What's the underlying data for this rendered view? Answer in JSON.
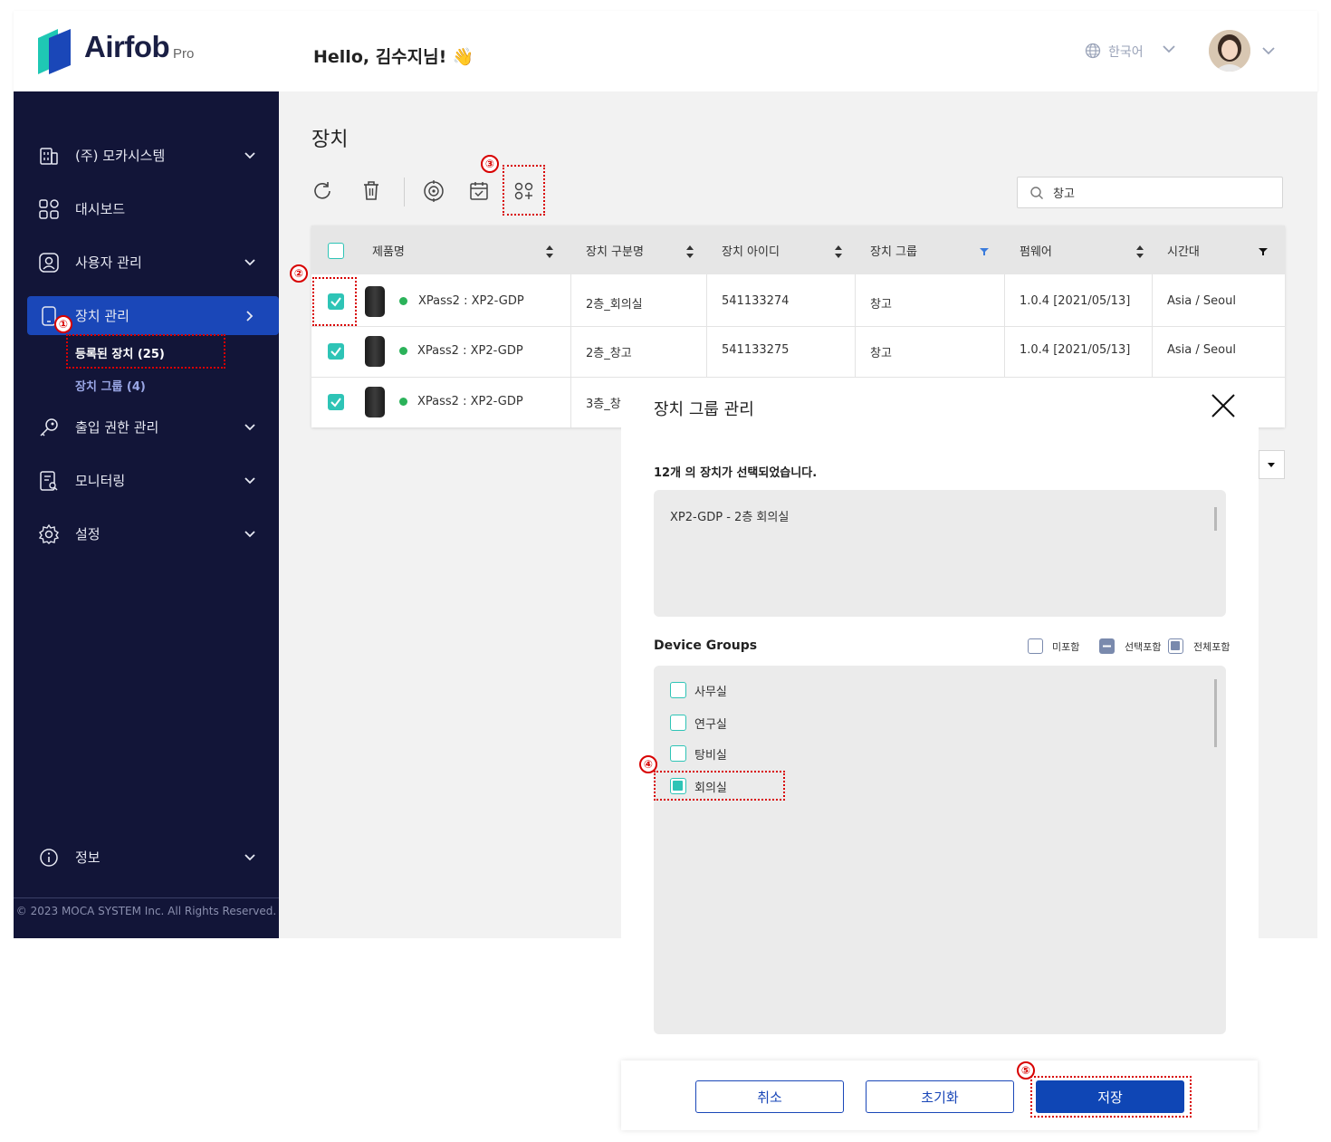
{
  "header": {
    "logo_text": "Airfob",
    "logo_sub": "Pro",
    "greeting": "Hello, 김수지님! 👋",
    "language": "한국어"
  },
  "sidebar": {
    "items": [
      {
        "label": "(주) 모카시스템",
        "icon": "building-icon"
      },
      {
        "label": "대시보드",
        "icon": "dashboard-icon"
      },
      {
        "label": "사용자 관리",
        "icon": "user-icon"
      },
      {
        "label": "장치 관리",
        "icon": "device-icon"
      },
      {
        "label": "출입 권한 관리",
        "icon": "key-icon"
      },
      {
        "label": "모니터링",
        "icon": "monitor-icon"
      },
      {
        "label": "설정",
        "icon": "gear-icon"
      },
      {
        "label": "정보",
        "icon": "info-icon"
      }
    ],
    "sub_items": [
      {
        "label": "등록된 장치 (25)"
      },
      {
        "label": "장치 그룹  (4)"
      }
    ],
    "copyright": "© 2023 MOCA SYSTEM Inc. All Rights Reserved."
  },
  "main": {
    "title": "장치",
    "search": {
      "value": "창고"
    },
    "table": {
      "columns": [
        "제품명",
        "장치 구분명",
        "장치 아이디",
        "장치 그룹",
        "펌웨어",
        "시간대"
      ],
      "rows": [
        {
          "product": "XPass2 : XP2-GDP",
          "name": "2층_회의실",
          "id": "541133274",
          "group": "창고",
          "firmware": "1.0.4 [2021/05/13]",
          "tz": "Asia / Seoul"
        },
        {
          "product": "XPass2 : XP2-GDP",
          "name": "2층_창고",
          "id": "541133275",
          "group": "창고",
          "firmware": "1.0.4 [2021/05/13]",
          "tz": "Asia / Seoul"
        },
        {
          "product": "XPass2 : XP2-GDP",
          "name": "3층_창",
          "id": "",
          "group": "",
          "firmware": "",
          "tz": ""
        }
      ]
    }
  },
  "modal": {
    "title": "장치 그룹 관리",
    "selected_text": "12개 의 장치가 선택되었습니다.",
    "selected_items": [
      "XP2-GDP - 2층 회의실"
    ],
    "groups_title": "Device Groups",
    "legend": [
      "미포함",
      "선택포함",
      "전체포함"
    ],
    "groups": [
      {
        "label": "사무실",
        "checked": false
      },
      {
        "label": "연구실",
        "checked": false
      },
      {
        "label": "탕비실",
        "checked": false
      },
      {
        "label": "회의실",
        "checked": true
      }
    ],
    "buttons": {
      "cancel": "취소",
      "reset": "초기화",
      "save": "저장"
    }
  },
  "annotations": [
    "①",
    "②",
    "③",
    "④",
    "⑤"
  ],
  "colors": {
    "sidebar_bg": "#121538",
    "active": "#1a47b8",
    "accent_teal": "#2ec4b6",
    "annotation": "#d80000",
    "status_online": "#2bb25a"
  }
}
